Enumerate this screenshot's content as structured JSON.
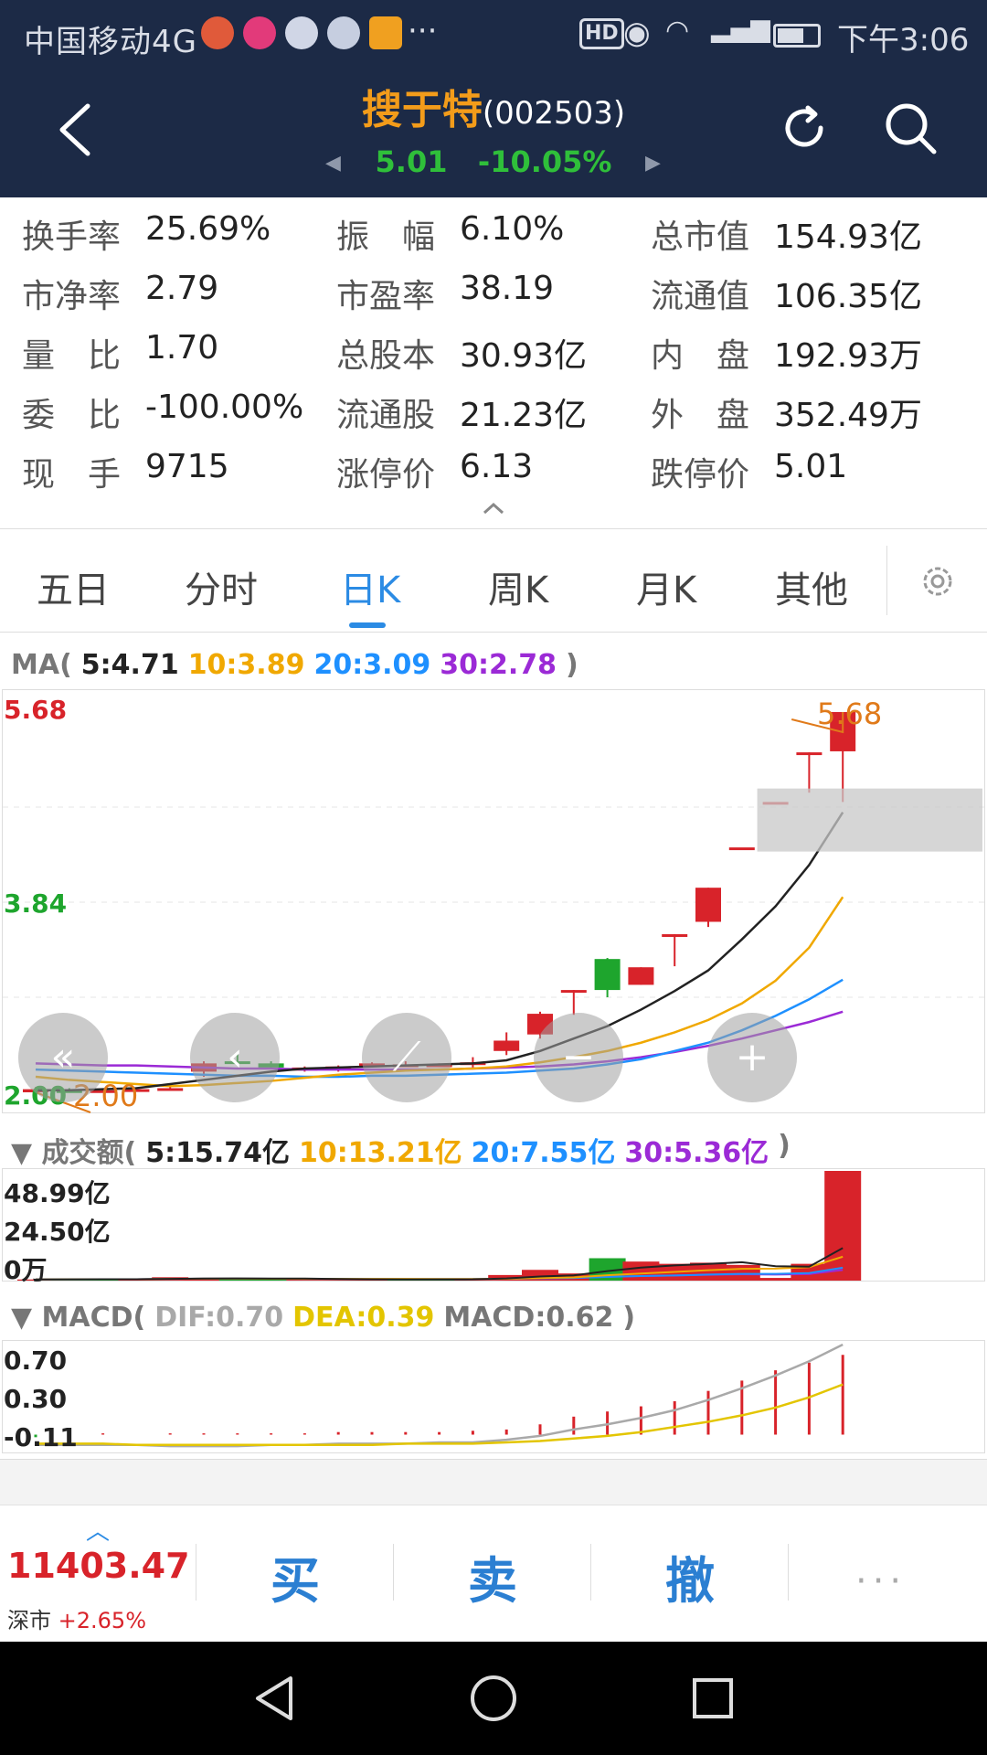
{
  "status_bar": {
    "carrier": "中国移动4G",
    "dots": "···",
    "hd": "HD",
    "time": "下午3:06"
  },
  "stock": {
    "name": "搜于特",
    "code": "(002503)",
    "price": "5.01",
    "change_pct": "-10.05%"
  },
  "info": [
    {
      "k": "换手率",
      "v": "25.69%"
    },
    {
      "k": "振　幅",
      "v": "6.10%"
    },
    {
      "k": "总市值",
      "v": "154.93亿"
    },
    {
      "k": "市净率",
      "v": "2.79"
    },
    {
      "k": "市盈率",
      "v": "38.19"
    },
    {
      "k": "流通值",
      "v": "106.35亿"
    },
    {
      "k": "量　比",
      "v": "1.70"
    },
    {
      "k": "总股本",
      "v": "30.93亿"
    },
    {
      "k": "内　盘",
      "v": "192.93万"
    },
    {
      "k": "委　比",
      "v": "-100.00%"
    },
    {
      "k": "流通股",
      "v": "21.23亿"
    },
    {
      "k": "外　盘",
      "v": "352.49万"
    },
    {
      "k": "现　手",
      "v": "9715"
    },
    {
      "k": "涨停价",
      "v": "6.13"
    },
    {
      "k": "跌停价",
      "v": "5.01"
    }
  ],
  "tabs": [
    "五日",
    "分时",
    "日K",
    "周K",
    "月K",
    "其他"
  ],
  "active_tab": "日K",
  "ma_legend": {
    "prefix": "MA(",
    "ma5": "5:4.71",
    "ma10": "10:3.89",
    "ma20": "20:3.09",
    "ma30": "30:2.78",
    "suffix": ")"
  },
  "price_axis": {
    "top": "5.68",
    "mid": "3.84",
    "bottom": "2.00",
    "high_mark": "5.68",
    "low_mark": "2.00"
  },
  "volume_legend": {
    "prefix": "▼ 成交额(",
    "v5": "5:15.74亿",
    "v10": "10:13.21亿",
    "v20": "20:7.55亿",
    "v30": "30:5.36亿",
    "suffix": ")"
  },
  "volume_axis": {
    "top": "48.99亿",
    "mid": "24.50亿",
    "bottom": "0万"
  },
  "macd_legend": {
    "prefix": "▼ MACD(",
    "dif": "DIF:0.70",
    "dea": "DEA:0.39",
    "macd": "MACD:0.62",
    "suffix": ")"
  },
  "macd_axis": {
    "top": "0.70",
    "mid": "0.30",
    "bottom": "-0.11"
  },
  "controls": [
    "«",
    "‹",
    "⟋",
    "−",
    "+"
  ],
  "trade_bar": {
    "index_value": "11403.47",
    "index_name": "深市",
    "index_pct": "+2.65%",
    "buy": "买",
    "sell": "卖",
    "cancel": "撤",
    "more": "···"
  },
  "colors": {
    "up": "#d8232a",
    "down": "#1ea52d",
    "ma5": "#222222",
    "ma10": "#f0a800",
    "ma20": "#1e90ff",
    "ma30": "#9b2ad6",
    "dif": "#a9a9a9",
    "dea": "#e3c500",
    "header": "#1c2a46"
  },
  "chart_data": {
    "type": "candlestick",
    "ylim": [
      2.0,
      5.68
    ],
    "candles": [
      {
        "o": 2.0,
        "c": 2.03,
        "h": 2.05,
        "l": 1.98
      },
      {
        "o": 2.02,
        "c": 2.01,
        "h": 2.04,
        "l": 2.0
      },
      {
        "o": 2.01,
        "c": 2.02,
        "h": 2.04,
        "l": 2.0
      },
      {
        "o": 2.02,
        "c": 2.03,
        "h": 2.05,
        "l": 2.01
      },
      {
        "o": 2.03,
        "c": 2.04,
        "h": 2.06,
        "l": 2.02
      },
      {
        "o": 2.2,
        "c": 2.28,
        "h": 2.3,
        "l": 2.15
      },
      {
        "o": 2.3,
        "c": 2.29,
        "h": 2.38,
        "l": 2.26
      },
      {
        "o": 2.28,
        "c": 2.24,
        "h": 2.3,
        "l": 2.22
      },
      {
        "o": 2.21,
        "c": 2.24,
        "h": 2.25,
        "l": 2.2
      },
      {
        "o": 2.22,
        "c": 2.25,
        "h": 2.26,
        "l": 2.2
      },
      {
        "o": 2.25,
        "c": 2.28,
        "h": 2.29,
        "l": 2.24
      },
      {
        "o": 2.27,
        "c": 2.27,
        "h": 2.3,
        "l": 2.25
      },
      {
        "o": 2.27,
        "c": 2.27,
        "h": 2.28,
        "l": 2.26
      },
      {
        "o": 2.27,
        "c": 2.29,
        "h": 2.34,
        "l": 2.24
      },
      {
        "o": 2.4,
        "c": 2.5,
        "h": 2.58,
        "l": 2.36
      },
      {
        "o": 2.56,
        "c": 2.76,
        "h": 2.78,
        "l": 2.52
      },
      {
        "o": 2.99,
        "c": 2.99,
        "h": 2.99,
        "l": 2.75
      },
      {
        "o": 3.29,
        "c": 2.99,
        "h": 3.3,
        "l": 2.92
      },
      {
        "o": 3.04,
        "c": 3.21,
        "h": 3.21,
        "l": 3.04
      },
      {
        "o": 3.53,
        "c": 3.53,
        "h": 3.53,
        "l": 3.22
      },
      {
        "o": 3.65,
        "c": 3.98,
        "h": 3.98,
        "l": 3.6
      },
      {
        "o": 4.37,
        "c": 4.37,
        "h": 4.37,
        "l": 4.37
      },
      {
        "o": 4.81,
        "c": 4.81,
        "h": 4.81,
        "l": 4.81
      },
      {
        "o": 5.29,
        "c": 5.29,
        "h": 5.29,
        "l": 4.9
      },
      {
        "o": 5.3,
        "c": 5.68,
        "h": 5.68,
        "l": 4.81
      }
    ],
    "ma5": [
      2.02,
      2.02,
      2.03,
      2.04,
      2.08,
      2.12,
      2.16,
      2.2,
      2.23,
      2.24,
      2.25,
      2.26,
      2.27,
      2.28,
      2.31,
      2.4,
      2.52,
      2.64,
      2.8,
      2.98,
      3.18,
      3.48,
      3.8,
      4.2,
      4.71
    ],
    "ma10": [
      2.15,
      2.12,
      2.1,
      2.08,
      2.06,
      2.07,
      2.09,
      2.11,
      2.14,
      2.17,
      2.19,
      2.21,
      2.22,
      2.23,
      2.25,
      2.29,
      2.34,
      2.4,
      2.48,
      2.58,
      2.7,
      2.86,
      3.08,
      3.4,
      3.89
    ],
    "ma20": [
      2.22,
      2.21,
      2.2,
      2.19,
      2.18,
      2.17,
      2.16,
      2.16,
      2.15,
      2.15,
      2.16,
      2.16,
      2.17,
      2.18,
      2.19,
      2.21,
      2.23,
      2.27,
      2.32,
      2.4,
      2.48,
      2.6,
      2.74,
      2.9,
      3.09
    ],
    "ma30": [
      2.28,
      2.27,
      2.26,
      2.26,
      2.25,
      2.24,
      2.23,
      2.23,
      2.22,
      2.22,
      2.22,
      2.22,
      2.22,
      2.23,
      2.24,
      2.25,
      2.27,
      2.3,
      2.34,
      2.39,
      2.45,
      2.52,
      2.6,
      2.68,
      2.78
    ],
    "volume": {
      "ylim": [
        0,
        48.99
      ],
      "values": [
        0.5,
        0.6,
        0.8,
        0.5,
        1.5,
        1.2,
        0.8,
        0.5,
        0.6,
        0.4,
        0.5,
        0.6,
        0.5,
        0.7,
        2.5,
        4.8,
        3.2,
        10.0,
        8.5,
        7.5,
        8.0,
        7.0,
        1.2,
        7.5,
        48.99
      ],
      "up": [
        true,
        false,
        false,
        true,
        true,
        true,
        false,
        false,
        true,
        true,
        true,
        false,
        false,
        true,
        true,
        true,
        true,
        false,
        true,
        true,
        true,
        true,
        true,
        true,
        true
      ]
    },
    "macd": {
      "ylim": [
        -0.11,
        0.7
      ],
      "dif": [
        -0.08,
        -0.08,
        -0.08,
        -0.08,
        -0.09,
        -0.09,
        -0.09,
        -0.08,
        -0.08,
        -0.07,
        -0.07,
        -0.07,
        -0.06,
        -0.06,
        -0.04,
        -0.01,
        0.04,
        0.08,
        0.13,
        0.19,
        0.27,
        0.36,
        0.46,
        0.57,
        0.7
      ],
      "dea": [
        -0.07,
        -0.07,
        -0.07,
        -0.08,
        -0.08,
        -0.08,
        -0.08,
        -0.08,
        -0.08,
        -0.08,
        -0.08,
        -0.07,
        -0.07,
        -0.07,
        -0.06,
        -0.05,
        -0.03,
        -0.01,
        0.02,
        0.06,
        0.1,
        0.15,
        0.21,
        0.29,
        0.39
      ],
      "hist": [
        -0.02,
        -0.02,
        0.01,
        0.0,
        0.01,
        0.01,
        0.01,
        0.01,
        0.01,
        0.02,
        0.02,
        0.02,
        0.02,
        0.03,
        0.04,
        0.08,
        0.14,
        0.18,
        0.22,
        0.26,
        0.34,
        0.42,
        0.5,
        0.56,
        0.62
      ]
    }
  }
}
